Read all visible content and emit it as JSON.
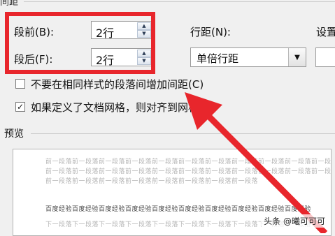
{
  "header": {
    "section_title": "间距"
  },
  "spacing": {
    "before": {
      "label": "段前(B):",
      "value": "2行"
    },
    "after": {
      "label": "段后(F):",
      "value": "2行"
    },
    "line_spacing": {
      "label": "行距(N):",
      "value": "单倍行距"
    },
    "set_value": {
      "label": "设置"
    }
  },
  "options": {
    "no_space_same_style": {
      "label": "不要在相同样式的段落间增加间距(C)",
      "checked": false
    },
    "snap_to_grid": {
      "label": "如果定义了文档网格，则对齐到网格(W)",
      "checked": true
    }
  },
  "preview": {
    "title": "预览",
    "prev_paragraph_lines": [
      "前一段落前一段落前一段落前一段落前一段落前一段落前一段落前一段落前一段落前一段落前一段落",
      "前一段落前一段落前一段落前一段落前一段落前一段落前一段落前一段落前一段落前一段落前一段落",
      "前一段落前一段落前一段落前一段落前一段落前一段落前一段落前一段落"
    ],
    "sample_line": "百度经验百度经验百度经验百度经验百度经验百度经验百度经验百度经验百度经验百度经验",
    "next_paragraph_line": "下一段落下一段落下一段落下一段落下一段落下一段落下一段落下一段落下一段落下一段落"
  },
  "watermark": "头条 @曦可可可",
  "colors": {
    "highlight": "#e8262c",
    "dialog_bg": "#f0f0f0"
  }
}
